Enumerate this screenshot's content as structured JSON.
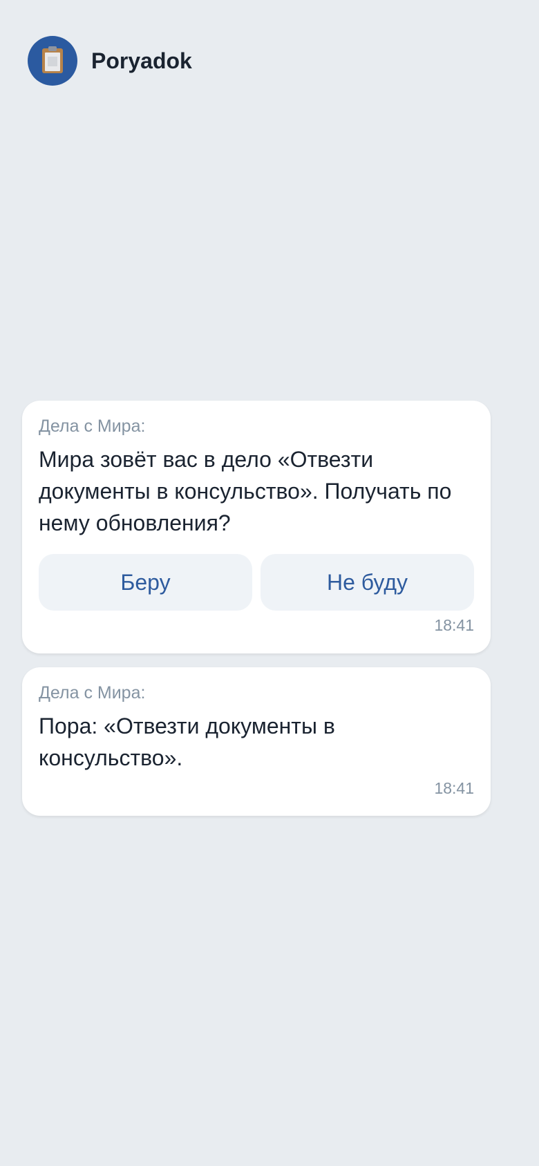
{
  "header": {
    "app_name": "Poryadok",
    "avatar_icon": "clipboard-icon",
    "avatar_color": "#2b5aa0"
  },
  "messages": [
    {
      "sender": "Дела с Мира:",
      "text": "Мира зовёт вас в дело «Отвезти документы в консульство». Получать по нему обновления?",
      "buttons": [
        {
          "label": "Беру"
        },
        {
          "label": "Не буду"
        }
      ],
      "time": "18:41"
    },
    {
      "sender": "Дела с Мира:",
      "text": "Пора: «Отвезти документы в консульство».",
      "time": "18:41"
    }
  ],
  "colors": {
    "background": "#e8ecf0",
    "button_text": "#2e5b9e",
    "secondary_text": "#8493a2"
  }
}
